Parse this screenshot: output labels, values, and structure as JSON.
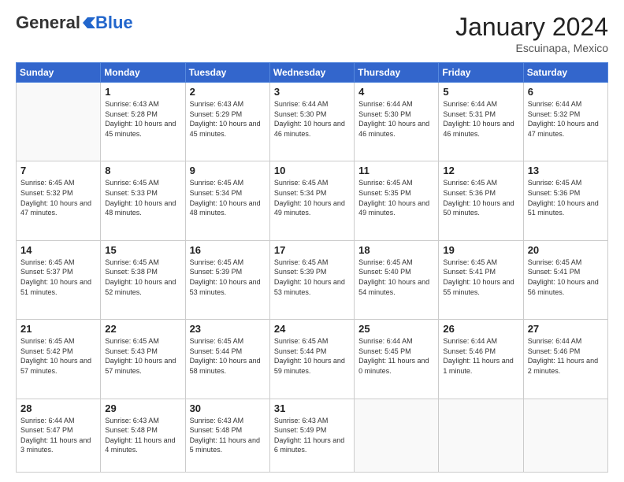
{
  "logo": {
    "general": "General",
    "blue": "Blue"
  },
  "title": "January 2024",
  "location": "Escuinapa, Mexico",
  "days_header": [
    "Sunday",
    "Monday",
    "Tuesday",
    "Wednesday",
    "Thursday",
    "Friday",
    "Saturday"
  ],
  "weeks": [
    [
      {
        "day": "",
        "info": ""
      },
      {
        "day": "1",
        "info": "Sunrise: 6:43 AM\nSunset: 5:28 PM\nDaylight: 10 hours\nand 45 minutes."
      },
      {
        "day": "2",
        "info": "Sunrise: 6:43 AM\nSunset: 5:29 PM\nDaylight: 10 hours\nand 45 minutes."
      },
      {
        "day": "3",
        "info": "Sunrise: 6:44 AM\nSunset: 5:30 PM\nDaylight: 10 hours\nand 46 minutes."
      },
      {
        "day": "4",
        "info": "Sunrise: 6:44 AM\nSunset: 5:30 PM\nDaylight: 10 hours\nand 46 minutes."
      },
      {
        "day": "5",
        "info": "Sunrise: 6:44 AM\nSunset: 5:31 PM\nDaylight: 10 hours\nand 46 minutes."
      },
      {
        "day": "6",
        "info": "Sunrise: 6:44 AM\nSunset: 5:32 PM\nDaylight: 10 hours\nand 47 minutes."
      }
    ],
    [
      {
        "day": "7",
        "info": "Sunrise: 6:45 AM\nSunset: 5:32 PM\nDaylight: 10 hours\nand 47 minutes."
      },
      {
        "day": "8",
        "info": "Sunrise: 6:45 AM\nSunset: 5:33 PM\nDaylight: 10 hours\nand 48 minutes."
      },
      {
        "day": "9",
        "info": "Sunrise: 6:45 AM\nSunset: 5:34 PM\nDaylight: 10 hours\nand 48 minutes."
      },
      {
        "day": "10",
        "info": "Sunrise: 6:45 AM\nSunset: 5:34 PM\nDaylight: 10 hours\nand 49 minutes."
      },
      {
        "day": "11",
        "info": "Sunrise: 6:45 AM\nSunset: 5:35 PM\nDaylight: 10 hours\nand 49 minutes."
      },
      {
        "day": "12",
        "info": "Sunrise: 6:45 AM\nSunset: 5:36 PM\nDaylight: 10 hours\nand 50 minutes."
      },
      {
        "day": "13",
        "info": "Sunrise: 6:45 AM\nSunset: 5:36 PM\nDaylight: 10 hours\nand 51 minutes."
      }
    ],
    [
      {
        "day": "14",
        "info": "Sunrise: 6:45 AM\nSunset: 5:37 PM\nDaylight: 10 hours\nand 51 minutes."
      },
      {
        "day": "15",
        "info": "Sunrise: 6:45 AM\nSunset: 5:38 PM\nDaylight: 10 hours\nand 52 minutes."
      },
      {
        "day": "16",
        "info": "Sunrise: 6:45 AM\nSunset: 5:39 PM\nDaylight: 10 hours\nand 53 minutes."
      },
      {
        "day": "17",
        "info": "Sunrise: 6:45 AM\nSunset: 5:39 PM\nDaylight: 10 hours\nand 53 minutes."
      },
      {
        "day": "18",
        "info": "Sunrise: 6:45 AM\nSunset: 5:40 PM\nDaylight: 10 hours\nand 54 minutes."
      },
      {
        "day": "19",
        "info": "Sunrise: 6:45 AM\nSunset: 5:41 PM\nDaylight: 10 hours\nand 55 minutes."
      },
      {
        "day": "20",
        "info": "Sunrise: 6:45 AM\nSunset: 5:41 PM\nDaylight: 10 hours\nand 56 minutes."
      }
    ],
    [
      {
        "day": "21",
        "info": "Sunrise: 6:45 AM\nSunset: 5:42 PM\nDaylight: 10 hours\nand 57 minutes."
      },
      {
        "day": "22",
        "info": "Sunrise: 6:45 AM\nSunset: 5:43 PM\nDaylight: 10 hours\nand 57 minutes."
      },
      {
        "day": "23",
        "info": "Sunrise: 6:45 AM\nSunset: 5:44 PM\nDaylight: 10 hours\nand 58 minutes."
      },
      {
        "day": "24",
        "info": "Sunrise: 6:45 AM\nSunset: 5:44 PM\nDaylight: 10 hours\nand 59 minutes."
      },
      {
        "day": "25",
        "info": "Sunrise: 6:44 AM\nSunset: 5:45 PM\nDaylight: 11 hours\nand 0 minutes."
      },
      {
        "day": "26",
        "info": "Sunrise: 6:44 AM\nSunset: 5:46 PM\nDaylight: 11 hours\nand 1 minute."
      },
      {
        "day": "27",
        "info": "Sunrise: 6:44 AM\nSunset: 5:46 PM\nDaylight: 11 hours\nand 2 minutes."
      }
    ],
    [
      {
        "day": "28",
        "info": "Sunrise: 6:44 AM\nSunset: 5:47 PM\nDaylight: 11 hours\nand 3 minutes."
      },
      {
        "day": "29",
        "info": "Sunrise: 6:43 AM\nSunset: 5:48 PM\nDaylight: 11 hours\nand 4 minutes."
      },
      {
        "day": "30",
        "info": "Sunrise: 6:43 AM\nSunset: 5:48 PM\nDaylight: 11 hours\nand 5 minutes."
      },
      {
        "day": "31",
        "info": "Sunrise: 6:43 AM\nSunset: 5:49 PM\nDaylight: 11 hours\nand 6 minutes."
      },
      {
        "day": "",
        "info": ""
      },
      {
        "day": "",
        "info": ""
      },
      {
        "day": "",
        "info": ""
      }
    ]
  ]
}
